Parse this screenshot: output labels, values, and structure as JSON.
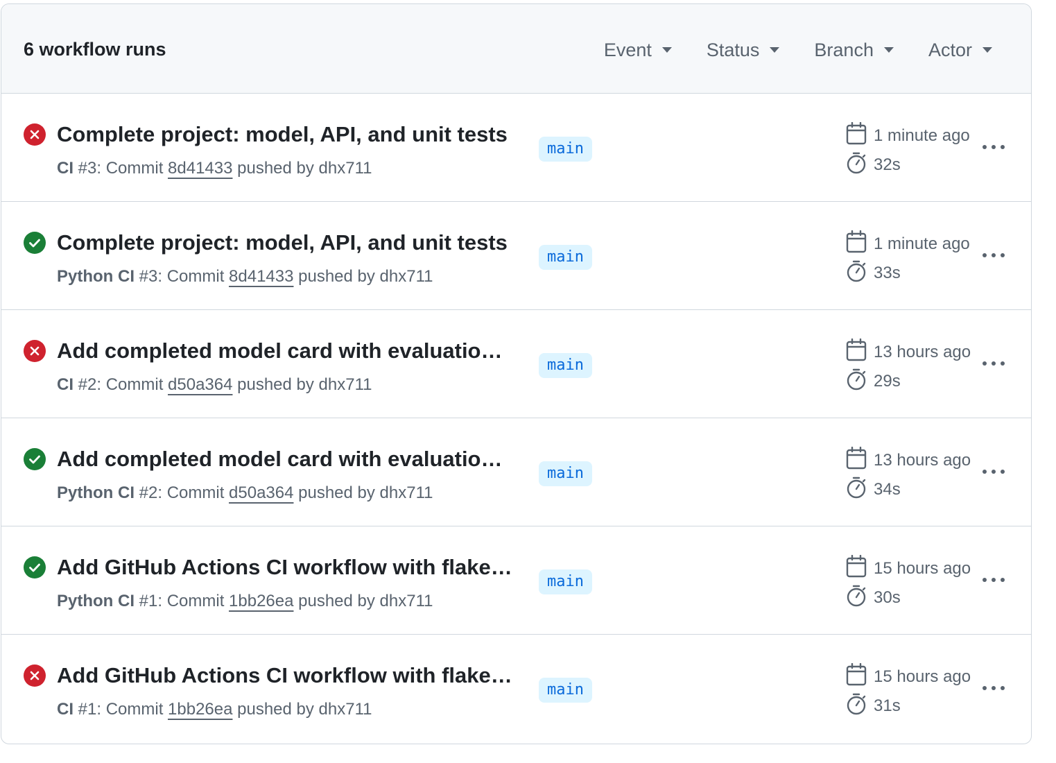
{
  "header": {
    "count_label": "6 workflow runs",
    "filters": [
      {
        "label": "Event"
      },
      {
        "label": "Status"
      },
      {
        "label": "Branch"
      },
      {
        "label": "Actor"
      }
    ]
  },
  "colors": {
    "failure": "#cf222e",
    "success": "#1a7f37",
    "branch_bg": "#ddf4ff",
    "branch_text": "#0969da"
  },
  "runs": [
    {
      "status": "failure",
      "status_icon": "x-circle-icon",
      "title": "Complete project: model, API, and unit tests",
      "workflow": "CI",
      "run_number": " #3: Commit ",
      "sha": "8d41433",
      "pushed_by": " pushed by dhx711",
      "branch": "main",
      "time_ago": "1 minute ago",
      "duration": "32s"
    },
    {
      "status": "success",
      "status_icon": "check-circle-icon",
      "title": "Complete project: model, API, and unit tests",
      "workflow": "Python CI",
      "run_number": " #3: Commit ",
      "sha": "8d41433",
      "pushed_by": " pushed by dhx711",
      "branch": "main",
      "time_ago": "1 minute ago",
      "duration": "33s"
    },
    {
      "status": "failure",
      "status_icon": "x-circle-icon",
      "title": "Add completed model card with evaluation…",
      "workflow": "CI",
      "run_number": " #2: Commit ",
      "sha": "d50a364",
      "pushed_by": " pushed by dhx711",
      "branch": "main",
      "time_ago": "13 hours ago",
      "duration": "29s"
    },
    {
      "status": "success",
      "status_icon": "check-circle-icon",
      "title": "Add completed model card with evaluation…",
      "workflow": "Python CI",
      "run_number": " #2: Commit ",
      "sha": "d50a364",
      "pushed_by": " pushed by dhx711",
      "branch": "main",
      "time_ago": "13 hours ago",
      "duration": "34s"
    },
    {
      "status": "success",
      "status_icon": "check-circle-icon",
      "title": "Add GitHub Actions CI workflow with flake…",
      "workflow": "Python CI",
      "run_number": " #1: Commit ",
      "sha": "1bb26ea",
      "pushed_by": " pushed by dhx711",
      "branch": "main",
      "time_ago": "15 hours ago",
      "duration": "30s"
    },
    {
      "status": "failure",
      "status_icon": "x-circle-icon",
      "title": "Add GitHub Actions CI workflow with flake…",
      "workflow": "CI",
      "run_number": " #1: Commit ",
      "sha": "1bb26ea",
      "pushed_by": " pushed by dhx711",
      "branch": "main",
      "time_ago": "15 hours ago",
      "duration": "31s"
    }
  ]
}
